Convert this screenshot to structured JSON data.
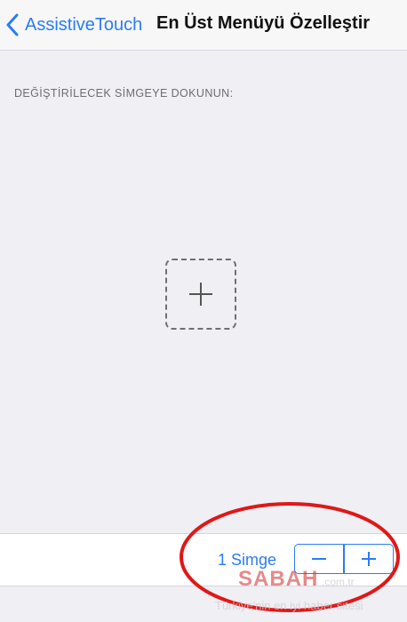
{
  "navbar": {
    "back_label": "AssistiveTouch",
    "title": "En Üst Menüyü Özelleştir",
    "back_icon": "chevron-left-icon"
  },
  "content": {
    "section_header": "DEĞİŞTİRİLECEK SİMGEYE DOKUNUN:",
    "add_slot_icon": "plus-icon"
  },
  "bottom_bar": {
    "count_label": "1 Simge",
    "decrement_icon": "minus-icon",
    "increment_icon": "plus-icon"
  },
  "watermark": {
    "brand": "SABAH",
    "domain": ".com.tr",
    "tagline": "Türkiye'nin en iyi haber sitesi"
  },
  "colors": {
    "accent": "#2b7cf5",
    "background": "#efeff4",
    "annotation": "#e01818"
  }
}
